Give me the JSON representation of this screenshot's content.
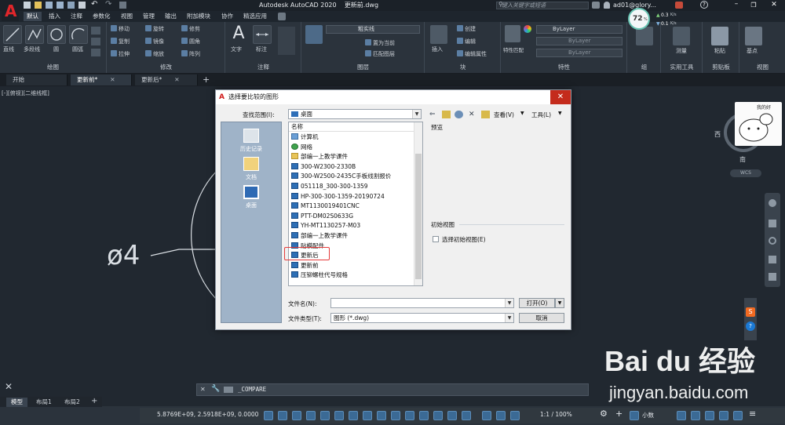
{
  "titlebar": {
    "app_title": "Autodesk AutoCAD 2020",
    "file_name": "更新前.dwg",
    "search_placeholder": "键入关键字或短语",
    "user": "ad01@glory...",
    "perf_percent": "72",
    "perf_up": "0.3",
    "perf_up_unit": "K/s",
    "perf_down": "0.1",
    "perf_down_unit": "K/s"
  },
  "ribbon_tabs": [
    "默认",
    "插入",
    "注释",
    "参数化",
    "视图",
    "管理",
    "输出",
    "附加模块",
    "协作",
    "精选应用"
  ],
  "ribbon": {
    "draw": {
      "label": "绘图",
      "line": "直线",
      "polyline": "多段线",
      "circle": "圆",
      "arc": "圆弧"
    },
    "modify": {
      "label": "修改",
      "move": "移动",
      "rotate": "旋转",
      "trim": "修剪",
      "copy": "复制",
      "mirror": "镜像",
      "fillet": "圆角",
      "stretch": "拉伸",
      "scale": "缩放",
      "array": "阵列"
    },
    "annotation": {
      "label": "注释",
      "text": "文字",
      "dim": "标注"
    },
    "layers": {
      "label": "图层",
      "layer_name": "粗实线",
      "match": "置为当前",
      "match_layer": "匹配图层"
    },
    "block": {
      "label": "块",
      "insert": "插入",
      "create": "创建",
      "edit": "编辑",
      "edit_attr": "编辑属性"
    },
    "properties": {
      "label": "特性",
      "match": "特性匹配",
      "bylayer1": "ByLayer",
      "bylayer2": "ByLayer",
      "bylayer3": "ByLayer"
    },
    "groups": {
      "label": "组"
    },
    "utilities": {
      "label": "实用工具",
      "measure": "测量"
    },
    "clipboard": {
      "label": "剪贴板",
      "paste": "粘贴"
    },
    "view": {
      "label": "视图",
      "base": "基点"
    }
  },
  "doc_tabs": [
    {
      "label": "开始",
      "active": false,
      "closable": false
    },
    {
      "label": "更新前*",
      "active": true,
      "closable": true
    },
    {
      "label": "更新后*",
      "active": false,
      "closable": true
    }
  ],
  "viewport_label": "[-][俯视][二维线框]",
  "drawing_text": "ø4",
  "viewcube": {
    "west": "西",
    "south": "南",
    "wcs": "WCS"
  },
  "dialog": {
    "title": "选择要比较的图形",
    "lookin_label": "查找范围(I):",
    "lookin_value": "桌面",
    "view_label": "查看(V)",
    "tools_label": "工具(L)",
    "places": [
      {
        "label": "历史记录"
      },
      {
        "label": "文档"
      },
      {
        "label": "桌面"
      }
    ],
    "list_header": "名称",
    "files": [
      {
        "name": "计算机",
        "type": "pc"
      },
      {
        "name": "网络",
        "type": "net"
      },
      {
        "name": "部编一上教学课件",
        "type": "folder"
      },
      {
        "name": "300-W2300-2330B",
        "type": "dwg"
      },
      {
        "name": "300-W2500-2435C手板线割报价",
        "type": "dwg"
      },
      {
        "name": "051118_300-300-1359",
        "type": "dwg"
      },
      {
        "name": "HP-300-300-1359-20190724",
        "type": "dwg"
      },
      {
        "name": "MT1130019401CNC",
        "type": "dwg"
      },
      {
        "name": "PTT-DM02S0633G",
        "type": "dwg"
      },
      {
        "name": "YH-MT1130257-M03",
        "type": "dwg"
      },
      {
        "name": "部编一上教学课件",
        "type": "dwg"
      },
      {
        "name": "贴模配件",
        "type": "dwg"
      },
      {
        "name": "更新后",
        "type": "dwg"
      },
      {
        "name": "更新前",
        "type": "dwg"
      },
      {
        "name": "压铆螺柱代号规格",
        "type": "dwg"
      }
    ],
    "preview_label": "预览",
    "initial_view_label": "初始视图",
    "select_initial_view": "选择初始视图(E)",
    "filename_label": "文件名(N):",
    "filename_value": "",
    "filetype_label": "文件类型(T):",
    "filetype_value": "图形 (*.dwg)",
    "open_button": "打开(O)",
    "cancel_button": "取消"
  },
  "sticker_text": "我的好",
  "command_line": "_COMPARE",
  "layout_tabs": [
    "模型",
    "布局1",
    "布局2"
  ],
  "status": {
    "coords": "5.8769E+09, 2.5918E+09, 0.0000",
    "scale": "1:1 / 100%",
    "units": "小数"
  },
  "watermark": {
    "logo": "Bai du 经验",
    "url": "jingyan.baidu.com"
  }
}
